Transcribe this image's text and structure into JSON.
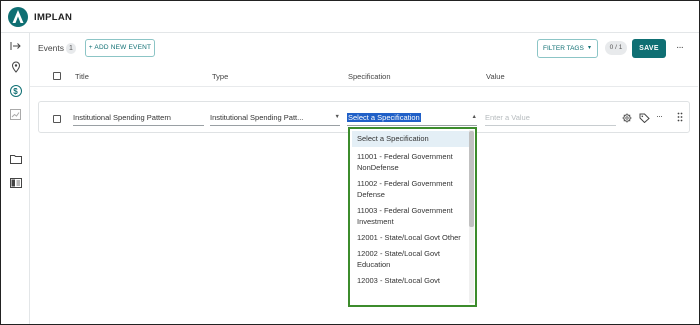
{
  "app": {
    "brand": "IMPLAN",
    "accent": "#0f6f73"
  },
  "rail": {
    "items": [
      "collapse-arrow-icon",
      "location-pin-icon",
      "dollar-icon",
      "chart-icon",
      "folder-icon",
      "book-icon"
    ]
  },
  "toolbar": {
    "events_label": "Events",
    "events_count": "1",
    "add_event_label": "+ ADD NEW EVENT",
    "filter_tags_label": "FILTER TAGS",
    "selection_count": "0 / 1",
    "save_label": "SAVE",
    "more_label": "···"
  },
  "table": {
    "headers": {
      "title": "Title",
      "type": "Type",
      "specification": "Specification",
      "value": "Value"
    }
  },
  "event_row": {
    "title": "Institutional Spending Pattern",
    "type": "Institutional Spending Patt...",
    "specification": "Select a Specification",
    "value_placeholder": "Enter a Value",
    "more_label": "···"
  },
  "dropdown": {
    "highlight_color": "#3c8c2c",
    "options": [
      "Select a Specification",
      "11001 - Federal Government NonDefense",
      "11002 - Federal Government Defense",
      "11003 - Federal Government Investment",
      "12001 - State/Local Govt Other",
      "12002 - State/Local Govt Education",
      "12003 - State/Local Govt"
    ]
  }
}
